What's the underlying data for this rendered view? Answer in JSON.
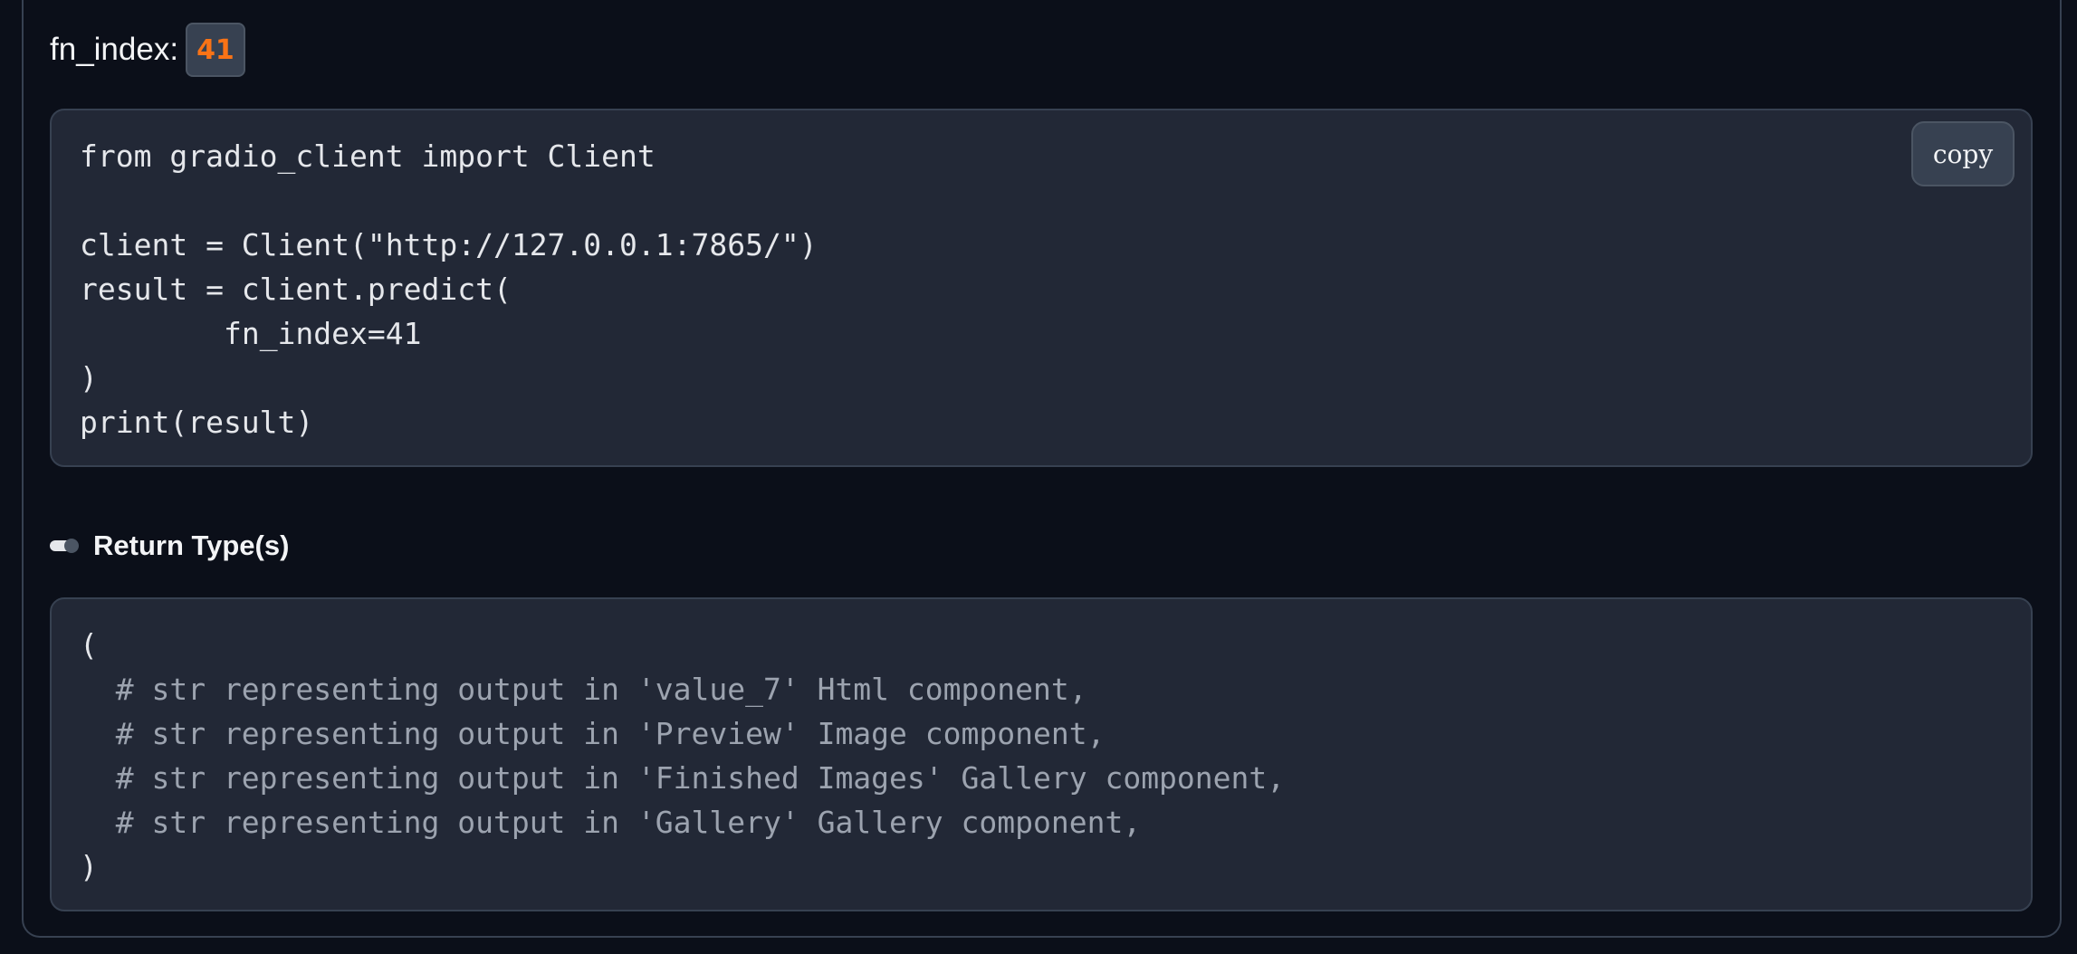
{
  "fn_index": {
    "label": "fn_index:",
    "value": "41"
  },
  "usage": {
    "copy_label": "copy",
    "lines": [
      "from gradio_client import Client",
      "",
      "client = Client(\"http://127.0.0.1:7865/\")",
      "result = client.predict(",
      "\t\tfn_index=41",
      ")",
      "print(result)"
    ]
  },
  "return_types": {
    "label": "Return Type(s)",
    "toggle_icon": "toggle-icon",
    "lines": [
      "(",
      "  # str representing output in 'value_7' Html component,",
      "  # str representing output in 'Preview' Image component,",
      "  # str representing output in 'Finished Images' Gallery component,",
      "  # str representing output in 'Gallery' Gallery component,",
      ")"
    ]
  },
  "colors": {
    "background": "#0b0f19",
    "code_background": "#222836",
    "accent": "#f97316",
    "comment": "#9ca3af"
  }
}
